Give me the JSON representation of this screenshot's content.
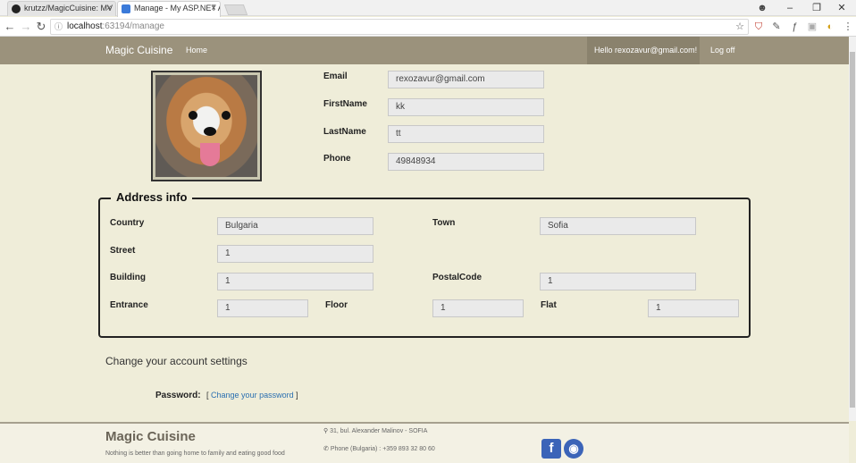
{
  "browser": {
    "tabs": [
      {
        "title": "krutzz/MagicCuisine: MV",
        "active": false
      },
      {
        "title": "Manage - My ASP.NET A",
        "active": true
      }
    ],
    "url_host": "localhost",
    "url_path": ":63194/manage",
    "controls": {
      "minimize": "–",
      "restore": "❐",
      "close": "✕"
    }
  },
  "navbar": {
    "brand": "Magic Cuisine",
    "home": "Home",
    "hello": "Hello rexozavur@gmail.com!",
    "logoff": "Log off"
  },
  "profile": {
    "fields": [
      {
        "label": "Email",
        "value": "rexozavur@gmail.com"
      },
      {
        "label": "FirstName",
        "value": "kk"
      },
      {
        "label": "LastName",
        "value": "tt"
      },
      {
        "label": "Phone",
        "value": "49848934"
      }
    ]
  },
  "address": {
    "legend": "Address info",
    "country_label": "Country",
    "country": "Bulgaria",
    "town_label": "Town",
    "town": "Sofia",
    "street_label": "Street",
    "street": "1",
    "building_label": "Building",
    "building": "1",
    "postal_label": "PostalCode",
    "postal": "1",
    "entrance_label": "Entrance",
    "entrance": "1",
    "floor_label": "Floor",
    "floor": "1",
    "flat_label": "Flat",
    "flat": "1"
  },
  "settings": {
    "heading": "Change your account settings",
    "password_label": "Password:",
    "bracket_open": "[",
    "change_password": "Change your password",
    "bracket_close": "]"
  },
  "footer": {
    "brand": "Magic Cuisine",
    "tagline": "Nothing is better than going home to family and eating good food",
    "address": "31, bul. Alexander Malinov - SOFIA",
    "phone": "Phone (Bulgaria) : +359 893 32 80 60",
    "facebook_glyph": "f",
    "github_glyph": "◉"
  },
  "colors": {
    "navbar": "#9b927c",
    "background": "#efedd9",
    "link": "#2a6fb0"
  }
}
